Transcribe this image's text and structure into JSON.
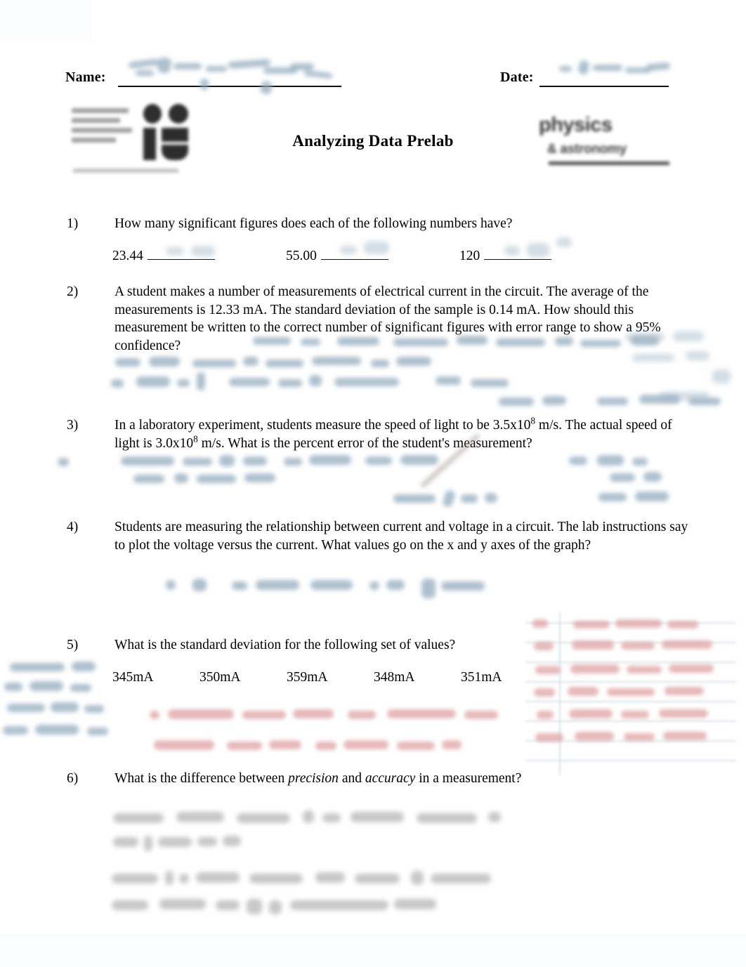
{
  "document": {
    "title": "Analyzing Data Prelab",
    "type": "worksheet-prelab"
  },
  "header": {
    "name_label": "Name:",
    "date_label": "Date:",
    "name_value": "",
    "date_value": "",
    "logo_left": {
      "name": "college-seal-logo",
      "line1": "",
      "line2": "",
      "line3": "",
      "line4": ""
    },
    "logo_right": {
      "name": "physics-astronomy-logo",
      "line1": "physics",
      "line2": "& astronomy"
    }
  },
  "questions": [
    {
      "number": "1)",
      "text": "How many significant figures does each of the following numbers have?",
      "answers": [
        {
          "value": "23.44",
          "answer": ""
        },
        {
          "value": "55.00",
          "answer": ""
        },
        {
          "value": "120",
          "answer": ""
        }
      ]
    },
    {
      "number": "2)",
      "text": "A student makes a number of measurements of electrical current in the circuit.  The average of the measurements is 12.33 mA.  The standard deviation of the sample is 0.14 mA.  How should this measurement be written to the correct number of significant figures with error range to show a 95% confidence?"
    },
    {
      "number": "3)",
      "text_parts": {
        "a": "In a laboratory experiment, students measure the speed of light to be 3.5x10",
        "sup1": "8",
        "b": " m/s.  The actual speed of light is 3.0x10",
        "sup2": "8",
        "c": " m/s.  What is the percent error of the student's measurement?"
      }
    },
    {
      "number": "4)",
      "text": "Students are measuring the relationship between current and voltage in a circuit.  The lab instructions say to plot the voltage versus the current.  What values go on the x and y axes of the graph?"
    },
    {
      "number": "5)",
      "text": "What is the standard deviation for the following set of values?",
      "values": [
        "345mA",
        "350mA",
        "359mA",
        "348mA",
        "351mA"
      ]
    },
    {
      "number": "6)",
      "text_parts": {
        "a": "What is the difference between ",
        "em1": "precision",
        "b": " and ",
        "em2": "accuracy",
        "c": " in a measurement?"
      }
    }
  ],
  "annotations": {
    "description": "Blurred handwritten answers and grader marks overlaying the printed worksheet",
    "blue_ink_color": "#8fa8bd",
    "red_ink_color": "#d98e90",
    "gray_pencil_color": "#9a9a9a"
  }
}
